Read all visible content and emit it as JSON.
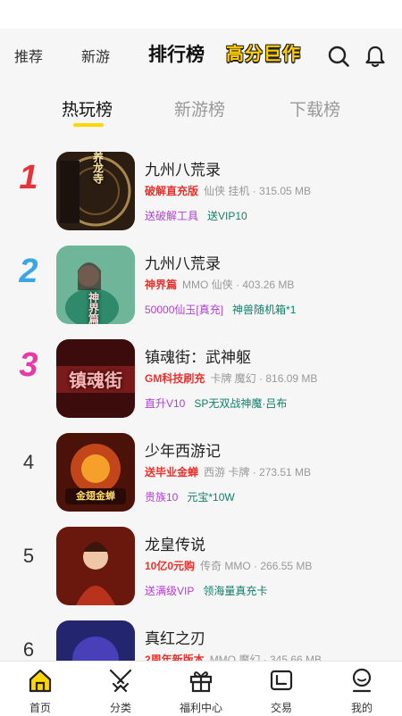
{
  "topnav": {
    "tabs": [
      "推荐",
      "新游",
      "排行榜"
    ],
    "banner": "高分巨作"
  },
  "subtabs": [
    "热玩榜",
    "新游榜",
    "下载榜"
  ],
  "colors": {
    "accent": "#ffd700",
    "highlight": "#e8322e",
    "tag_purple": "#b23fd1",
    "tag_green": "#11806b"
  },
  "games": [
    {
      "rank": "1",
      "rank_color": "#e8323a",
      "title": "九州八荒录",
      "highlight": "破解直充版",
      "info": "仙侠 挂机 · 315.05 MB",
      "tag1": "送破解工具",
      "tag2": "送VIP10",
      "art": "养龙寺",
      "bg": "#3a2a1c"
    },
    {
      "rank": "2",
      "rank_color": "#3aa6e8",
      "title": "九州八荒录",
      "highlight": "神界篇",
      "info": "MMO 仙侠 · 403.26 MB",
      "tag1": "50000仙玉[真充]",
      "tag2": "神兽随机箱*1",
      "art": "神界篇",
      "bg": "#4e9a7c"
    },
    {
      "rank": "3",
      "rank_color": "#e83aa6",
      "title": "镇魂街：武神躯",
      "highlight": "GM科技刷充",
      "info": "卡牌 魔幻 · 816.09 MB",
      "tag1": "直升V10",
      "tag2": "SP无双战神魔·吕布",
      "art": "镇魂街",
      "bg": "#5a1616"
    },
    {
      "rank": "4",
      "rank_color": "#333333",
      "title": "少年西游记",
      "highlight": "送毕业金蝉",
      "info": "西游 卡牌 · 273.51 MB",
      "tag1": "贵族10",
      "tag2": "元宝*10W",
      "art": "金翅金蝉",
      "bg": "#6a1c0c"
    },
    {
      "rank": "5",
      "rank_color": "#333333",
      "title": "龙皇传说",
      "highlight": "10亿0元购",
      "info": "传奇 MMO · 266.55 MB",
      "tag1": "送满级VIP",
      "tag2": "领海量真充卡",
      "art": "",
      "bg": "#7a2418"
    },
    {
      "rank": "6",
      "rank_color": "#333333",
      "title": "真红之刃",
      "highlight": "2周年新版本",
      "info": "MMO 魔幻 · 345.66 MB",
      "tag1": "",
      "tag2": "",
      "art": "",
      "bg": "#2a2e7a"
    }
  ],
  "bottomnav": [
    {
      "label": "首页",
      "icon": "home-icon"
    },
    {
      "label": "分类",
      "icon": "swords-icon"
    },
    {
      "label": "福利中心",
      "icon": "gift-icon"
    },
    {
      "label": "交易",
      "icon": "trade-icon"
    },
    {
      "label": "我的",
      "icon": "profile-icon"
    }
  ]
}
